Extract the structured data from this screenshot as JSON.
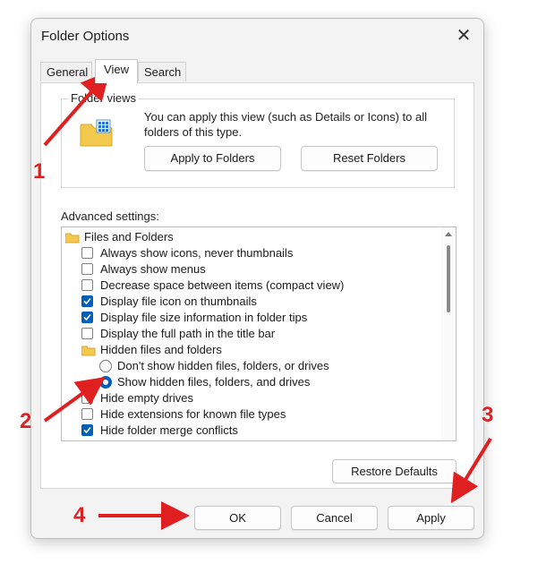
{
  "dialog": {
    "title": "Folder Options",
    "close_glyph": "✕",
    "tabs": [
      {
        "label": "General",
        "active": false
      },
      {
        "label": "View",
        "active": true
      },
      {
        "label": "Search",
        "active": false
      }
    ],
    "folder_views": {
      "legend": "Folder views",
      "description": "You can apply this view (such as Details or Icons) to all folders of this type.",
      "apply_button": "Apply to Folders",
      "reset_button": "Reset Folders"
    },
    "advanced": {
      "label": "Advanced settings:",
      "items": [
        {
          "type": "folder",
          "label": "Files and Folders"
        },
        {
          "type": "checkbox",
          "label": "Always show icons, never thumbnails",
          "checked": false
        },
        {
          "type": "checkbox",
          "label": "Always show menus",
          "checked": false
        },
        {
          "type": "checkbox",
          "label": "Decrease space between items (compact view)",
          "checked": false
        },
        {
          "type": "checkbox",
          "label": "Display file icon on thumbnails",
          "checked": true
        },
        {
          "type": "checkbox",
          "label": "Display file size information in folder tips",
          "checked": true
        },
        {
          "type": "checkbox",
          "label": "Display the full path in the title bar",
          "checked": false
        },
        {
          "type": "folder",
          "label": "Hidden files and folders"
        },
        {
          "type": "radio",
          "label": "Don't show hidden files, folders, or drives",
          "checked": false
        },
        {
          "type": "radio",
          "label": "Show hidden files, folders, and drives",
          "checked": true
        },
        {
          "type": "checkbox",
          "label": "Hide empty drives",
          "checked": false
        },
        {
          "type": "checkbox",
          "label": "Hide extensions for known file types",
          "checked": false
        },
        {
          "type": "checkbox",
          "label": "Hide folder merge conflicts",
          "checked": true
        }
      ]
    },
    "restore_defaults_button": "Restore Defaults",
    "ok_button": "OK",
    "cancel_button": "Cancel",
    "apply_button": "Apply"
  },
  "annotations": {
    "step1": "1",
    "step2": "2",
    "step3": "3",
    "step4": "4",
    "color": "#e02020"
  },
  "colors": {
    "accent": "#005fb8",
    "dialog_bg": "#f3f3f3",
    "folder_yellow": "#f2c94c"
  }
}
